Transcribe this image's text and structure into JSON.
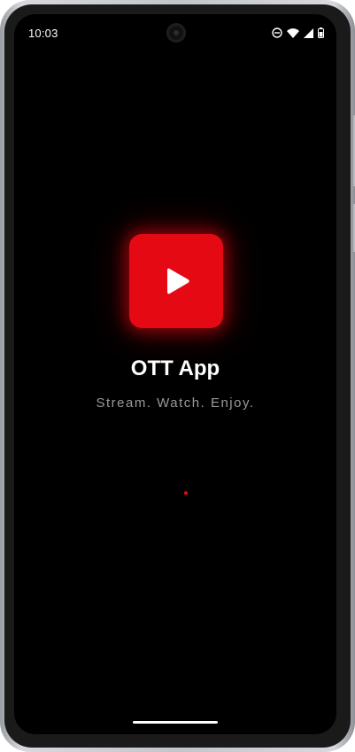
{
  "status_bar": {
    "time": "10:03",
    "icons": [
      "do-not-disturb-icon",
      "wifi-icon",
      "cellular-signal-icon",
      "battery-icon"
    ]
  },
  "splash": {
    "logo_icon": "play-icon",
    "title": "OTT App",
    "tagline": "Stream. Watch. Enjoy."
  },
  "colors": {
    "brand": "#e50914",
    "background": "#000000",
    "title": "#ffffff",
    "tagline": "#9a9a9a"
  }
}
